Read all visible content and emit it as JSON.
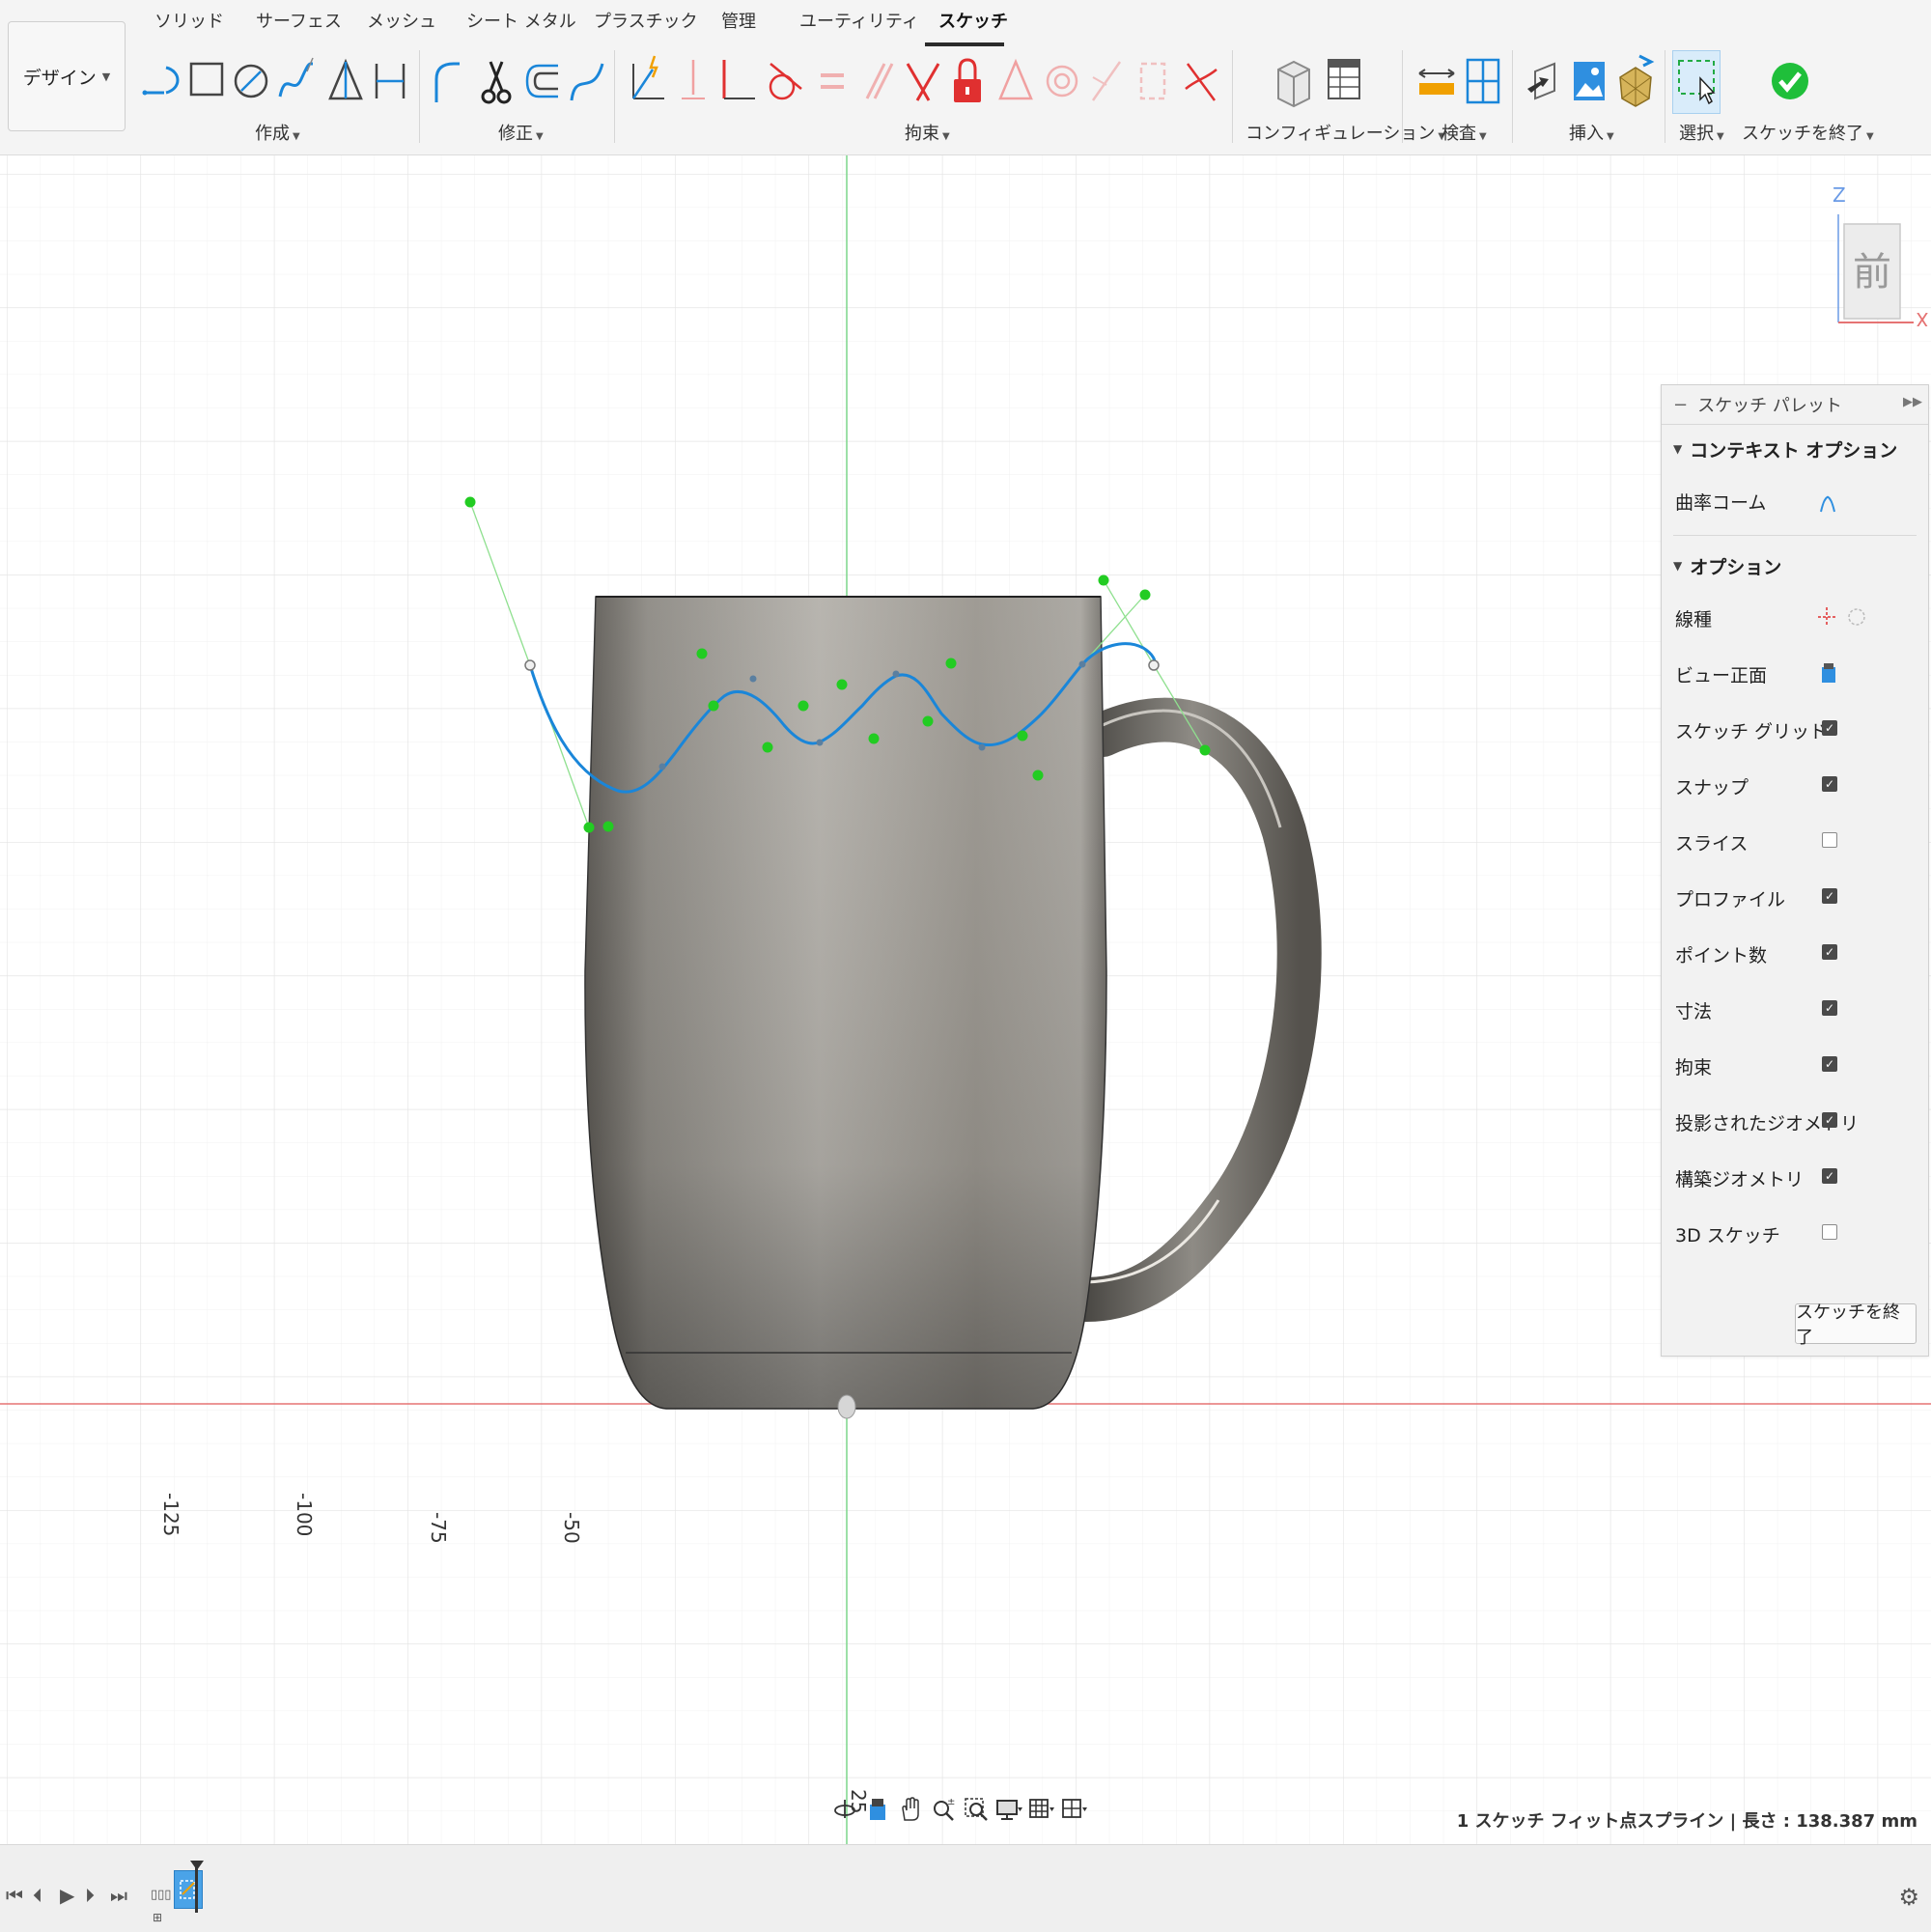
{
  "toolbar": {
    "design_label": "デザイン",
    "tabs": [
      "ソリッド",
      "サーフェス",
      "メッシュ",
      "シート メタル",
      "プラスチック",
      "管理",
      "ユーティリティ",
      "スケッチ"
    ],
    "active_tab": "スケッチ",
    "groups": {
      "create": "作成",
      "modify": "修正",
      "constraints": "拘束",
      "configuration": "コンフィギュレーション",
      "inspect": "検査",
      "insert": "挿入",
      "select": "選択",
      "finish": "スケッチを終了"
    }
  },
  "viewport": {
    "ruler_labels": [
      "-125",
      "-100",
      "-75",
      "-50",
      "25"
    ],
    "viewcube": {
      "face": "前",
      "axis_z": "Z",
      "axis_x": "X"
    }
  },
  "palette": {
    "title": "スケッチ パレット",
    "context_section": "コンテキスト オプション",
    "curvature_comb": "曲率コーム",
    "options_section": "オプション",
    "line_type": "線種",
    "look_at": "ビュー正面",
    "options": [
      {
        "label": "スケッチ グリッド",
        "checked": true
      },
      {
        "label": "スナップ",
        "checked": true
      },
      {
        "label": "スライス",
        "checked": false
      },
      {
        "label": "プロファイル",
        "checked": true
      },
      {
        "label": "ポイント数",
        "checked": true
      },
      {
        "label": "寸法",
        "checked": true
      },
      {
        "label": "拘束",
        "checked": true
      },
      {
        "label": "投影されたジオメトリ",
        "checked": true
      },
      {
        "label": "構築ジオメトリ",
        "checked": true
      },
      {
        "label": "3D スケッチ",
        "checked": false
      }
    ],
    "finish_button": "スケッチを終了"
  },
  "status_bar": {
    "selection_text": "1 スケッチ フィット点スプライン | 長さ : 138.387 mm"
  },
  "colors": {
    "spline": "#1a86d9",
    "handle": "#22cc22",
    "axis_red": "#e57373",
    "axis_green": "#7cd68a"
  }
}
